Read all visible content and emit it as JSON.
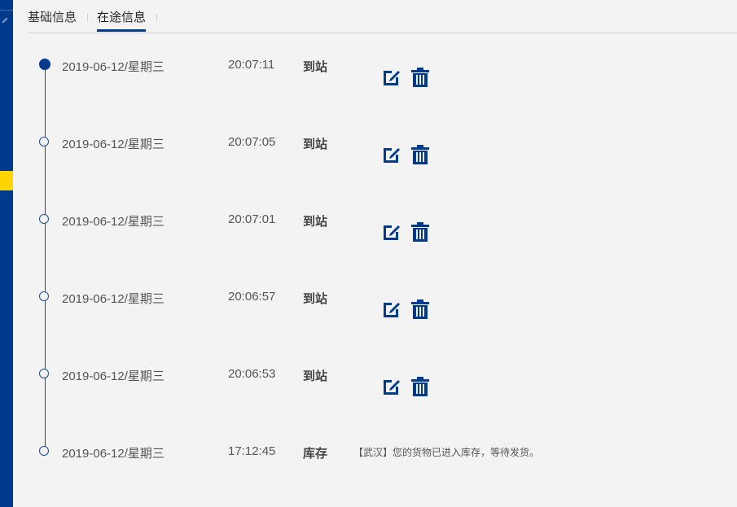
{
  "tabs": [
    {
      "label": "基础信息"
    },
    {
      "label": "在途信息"
    }
  ],
  "timeline": [
    {
      "date": "2019-06-12/星期三",
      "time": "20:07:11",
      "status": "到站",
      "desc": ""
    },
    {
      "date": "2019-06-12/星期三",
      "time": "20:07:05",
      "status": "到站",
      "desc": ""
    },
    {
      "date": "2019-06-12/星期三",
      "time": "20:07:01",
      "status": "到站",
      "desc": ""
    },
    {
      "date": "2019-06-12/星期三",
      "time": "20:06:57",
      "status": "到站",
      "desc": ""
    },
    {
      "date": "2019-06-12/星期三",
      "time": "20:06:53",
      "status": "到站",
      "desc": ""
    },
    {
      "date": "2019-06-12/星期三",
      "time": "17:12:45",
      "status": "库存",
      "desc": "【武汉】您的货物已进入库存，等待发货。"
    }
  ],
  "icons": {
    "edit": "edit-icon",
    "delete": "trash-icon"
  },
  "colors": {
    "accent": "#003a8c",
    "highlight": "#ffd500",
    "background": "#f3f3f3"
  }
}
